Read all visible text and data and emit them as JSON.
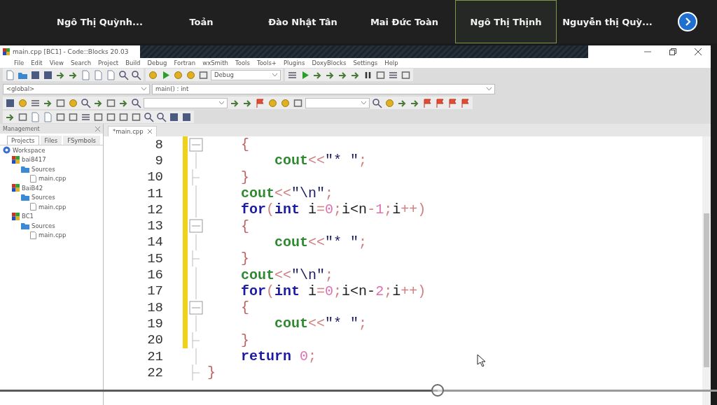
{
  "participants": [
    {
      "name": "Ngô Thị Quỳnh...",
      "selected": false
    },
    {
      "name": "Toản",
      "selected": false
    },
    {
      "name": "Đào Nhật Tân",
      "selected": false
    },
    {
      "name": "Mai Đức Toàn",
      "selected": false
    },
    {
      "name": "Ngô Thị Thịnh",
      "selected": true
    },
    {
      "name": "Nguyễn thị Quỳ...",
      "selected": false
    }
  ],
  "window": {
    "title": "main.cpp [BC1] - Code::Blocks 20.03"
  },
  "menu": [
    "File",
    "Edit",
    "View",
    "Search",
    "Project",
    "Build",
    "Debug",
    "Fortran",
    "wxSmith",
    "Tools",
    "Tools+",
    "Plugins",
    "DoxyBlocks",
    "Settings",
    "Help"
  ],
  "toolbar": {
    "build_target": "Debug",
    "scope": "<global>",
    "symbol": "main() : int"
  },
  "management": {
    "title": "Management",
    "tabs": [
      {
        "label": "Projects",
        "selected": true
      },
      {
        "label": "Files",
        "selected": false
      },
      {
        "label": "FSymbols",
        "selected": false
      }
    ],
    "tree": [
      {
        "label": "Workspace",
        "kind": "workspace",
        "children": [
          {
            "label": "bai8417",
            "kind": "project",
            "children": [
              {
                "label": "Sources",
                "kind": "folder",
                "children": [
                  {
                    "label": "main.cpp",
                    "kind": "file"
                  }
                ]
              }
            ]
          },
          {
            "label": "BaiB42",
            "kind": "project",
            "children": [
              {
                "label": "Sources",
                "kind": "folder",
                "children": [
                  {
                    "label": "main.cpp",
                    "kind": "file"
                  }
                ]
              }
            ]
          },
          {
            "label": "BC1",
            "kind": "project",
            "children": [
              {
                "label": "Sources",
                "kind": "folder",
                "children": [
                  {
                    "label": "main.cpp",
                    "kind": "file"
                  }
                ]
              }
            ]
          }
        ]
      }
    ]
  },
  "editor": {
    "tab": "*main.cpp",
    "lines": [
      {
        "number": "8",
        "kind": "fold_start",
        "changed": true,
        "segments": [
          {
            "kind": "brace",
            "text": "    {"
          }
        ]
      },
      {
        "number": "9",
        "kind": "fold_line",
        "changed": true,
        "segments": [
          {
            "kind": "stream",
            "text": "        cout"
          },
          {
            "kind": "op",
            "text": "<<"
          },
          {
            "kind": "string",
            "text": "\"* \""
          },
          {
            "kind": "op",
            "text": ";"
          }
        ]
      },
      {
        "number": "10",
        "kind": "fold_end",
        "changed": true,
        "segments": [
          {
            "kind": "brace",
            "text": "    }"
          }
        ]
      },
      {
        "number": "11",
        "kind": "fold_line",
        "changed": true,
        "segments": [
          {
            "kind": "stream",
            "text": "    cout"
          },
          {
            "kind": "op",
            "text": "<<"
          },
          {
            "kind": "string",
            "text": "\"\\n\""
          },
          {
            "kind": "op",
            "text": ";"
          }
        ]
      },
      {
        "number": "12",
        "kind": "fold_line",
        "changed": true,
        "segments": [
          {
            "kind": "keyword",
            "text": "    for"
          },
          {
            "kind": "op",
            "text": "("
          },
          {
            "kind": "keyword",
            "text": "int"
          },
          {
            "kind": "plain",
            "text": " i"
          },
          {
            "kind": "op",
            "text": "="
          },
          {
            "kind": "number",
            "text": "0"
          },
          {
            "kind": "op",
            "text": ";"
          },
          {
            "kind": "plain",
            "text": "i<n"
          },
          {
            "kind": "op",
            "text": "-"
          },
          {
            "kind": "number",
            "text": "1"
          },
          {
            "kind": "op",
            "text": ";"
          },
          {
            "kind": "plain",
            "text": "i"
          },
          {
            "kind": "op",
            "text": "++)"
          }
        ]
      },
      {
        "number": "13",
        "kind": "fold_start",
        "changed": true,
        "segments": [
          {
            "kind": "brace",
            "text": "    {"
          }
        ]
      },
      {
        "number": "14",
        "kind": "fold_line",
        "changed": true,
        "segments": [
          {
            "kind": "stream",
            "text": "        cout"
          },
          {
            "kind": "op",
            "text": "<<"
          },
          {
            "kind": "string",
            "text": "\"* \""
          },
          {
            "kind": "op",
            "text": ";"
          }
        ]
      },
      {
        "number": "15",
        "kind": "fold_end",
        "changed": true,
        "segments": [
          {
            "kind": "brace",
            "text": "    }"
          }
        ]
      },
      {
        "number": "16",
        "kind": "fold_line",
        "changed": true,
        "segments": [
          {
            "kind": "stream",
            "text": "    cout"
          },
          {
            "kind": "op",
            "text": "<<"
          },
          {
            "kind": "string",
            "text": "\"\\n\""
          },
          {
            "kind": "op",
            "text": ";"
          }
        ]
      },
      {
        "number": "17",
        "kind": "fold_line",
        "changed": true,
        "segments": [
          {
            "kind": "keyword",
            "text": "    for"
          },
          {
            "kind": "op",
            "text": "("
          },
          {
            "kind": "keyword",
            "text": "int"
          },
          {
            "kind": "plain",
            "text": " i"
          },
          {
            "kind": "op",
            "text": "="
          },
          {
            "kind": "number",
            "text": "0"
          },
          {
            "kind": "op",
            "text": ";"
          },
          {
            "kind": "plain",
            "text": "i<n-"
          },
          {
            "kind": "number",
            "text": "2"
          },
          {
            "kind": "op",
            "text": ";"
          },
          {
            "kind": "plain",
            "text": "i"
          },
          {
            "kind": "op",
            "text": "++)"
          }
        ]
      },
      {
        "number": "18",
        "kind": "fold_start",
        "changed": true,
        "segments": [
          {
            "kind": "brace",
            "text": "    {"
          }
        ]
      },
      {
        "number": "19",
        "kind": "fold_line",
        "changed": true,
        "segments": [
          {
            "kind": "stream",
            "text": "        cout"
          },
          {
            "kind": "op",
            "text": "<<"
          },
          {
            "kind": "string",
            "text": "\"* \""
          },
          {
            "kind": "op",
            "text": ";"
          }
        ]
      },
      {
        "number": "20",
        "kind": "fold_end",
        "changed": true,
        "segments": [
          {
            "kind": "brace",
            "text": "    }"
          }
        ]
      },
      {
        "number": "21",
        "kind": "fold_line",
        "changed": false,
        "segments": [
          {
            "kind": "keyword",
            "text": "    return"
          },
          {
            "kind": "number",
            "text": " 0"
          },
          {
            "kind": "op",
            "text": ";"
          }
        ]
      },
      {
        "number": "22",
        "kind": "fold_end",
        "changed": false,
        "segments": [
          {
            "kind": "brace",
            "text": "}"
          }
        ]
      }
    ]
  },
  "player": {
    "seek": {
      "level": 0.61
    }
  }
}
